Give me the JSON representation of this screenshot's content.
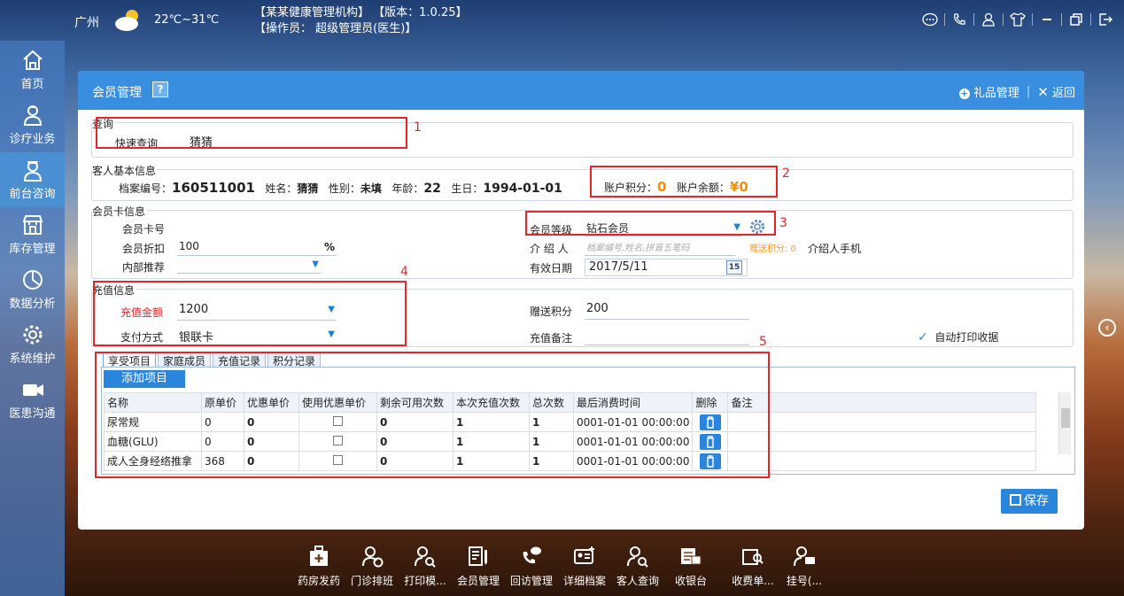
{
  "topbar": {
    "city": "广州",
    "temp": "22℃~31℃",
    "info_line1": "【某某健康管理机构】 【版本：1.0.25】",
    "info_line2": "【操作员： 超级管理员(医生)】"
  },
  "sidebar": {
    "items": [
      {
        "label": "首页"
      },
      {
        "label": "诊疗业务"
      },
      {
        "label": "前台咨询"
      },
      {
        "label": "库存管理"
      },
      {
        "label": "数据分析"
      },
      {
        "label": "系统维护"
      },
      {
        "label": "医患沟通"
      }
    ]
  },
  "panel": {
    "title": "会员管理",
    "help": "?",
    "gift_label": "礼品管理",
    "back_label": "返回"
  },
  "query": {
    "group_label": "查询",
    "quick_label": "快速查询",
    "quick_value": "猜猜"
  },
  "guest": {
    "group_label": "客人基本信息",
    "file_label": "档案编号：",
    "file_value": "160511001",
    "name_label": "姓名：",
    "name_value": "猜猜",
    "gender_label": "性别：",
    "gender_value": "未填",
    "age_label": "年龄：",
    "age_value": "22",
    "birth_label": "生日：",
    "birth_value": "1994-01-01",
    "points_label": "账户积分：",
    "points_value": "0",
    "balance_label": "账户余额：",
    "balance_value": "¥0"
  },
  "card": {
    "group_label": "会员卡信息",
    "card_no_label": "会员卡号",
    "discount_label": "会员折扣",
    "discount_value": "100",
    "percent": "%",
    "referral_label": "内部推荐",
    "level_label": "会员等级",
    "level_value": "钻石会员",
    "introducer_label": "介 绍 人",
    "introducer_placeholder": "档案编号,姓名,拼音五笔码",
    "bonus_points": "赠送积分: 0",
    "introducer_phone_label": "介绍人手机",
    "valid_label": "有效日期",
    "valid_value": "2017/5/11",
    "calendar_day": "15"
  },
  "recharge": {
    "group_label": "充值信息",
    "amount_label": "充值金额",
    "amount_value": "1200",
    "pay_label": "支付方式",
    "pay_value": "银联卡",
    "gift_points_label": "赠送积分",
    "gift_points_value": "200",
    "remark_label": "充值备注",
    "auto_print_label": "自动打印收据"
  },
  "annotations": [
    "1",
    "2",
    "3",
    "4",
    "5"
  ],
  "tabs": [
    "享受项目",
    "家庭成员",
    "充值记录",
    "积分记录"
  ],
  "add_item_label": "添加项目",
  "table": {
    "headers": [
      "名称",
      "原单价",
      "优惠单价",
      "使用优惠单价",
      "剩余可用次数",
      "本次充值次数",
      "总次数",
      "最后消费时间",
      "删除",
      "备注"
    ],
    "rows": [
      {
        "name": "尿常规",
        "price": "0",
        "discount": "0",
        "remain": "0",
        "this": "1",
        "total": "1",
        "last": "0001-01-01 00:00:00"
      },
      {
        "name": "血糖(GLU)",
        "price": "0",
        "discount": "0",
        "remain": "0",
        "this": "1",
        "total": "1",
        "last": "0001-01-01 00:00:00"
      },
      {
        "name": "成人全身经络推拿",
        "price": "368",
        "discount": "0",
        "remain": "0",
        "this": "1",
        "total": "1",
        "last": "0001-01-01 00:00:00"
      }
    ]
  },
  "save_label": "保存",
  "dock": [
    "药房发药",
    "门诊排班",
    "打印模...",
    "会员管理",
    "回访管理",
    "详细档案",
    "客人查询",
    "收银台",
    "收费单...",
    "挂号(..."
  ],
  "colors": {
    "accent": "#3a8ee0",
    "highlight": "#e5252a",
    "amount": "#ff8a00"
  }
}
